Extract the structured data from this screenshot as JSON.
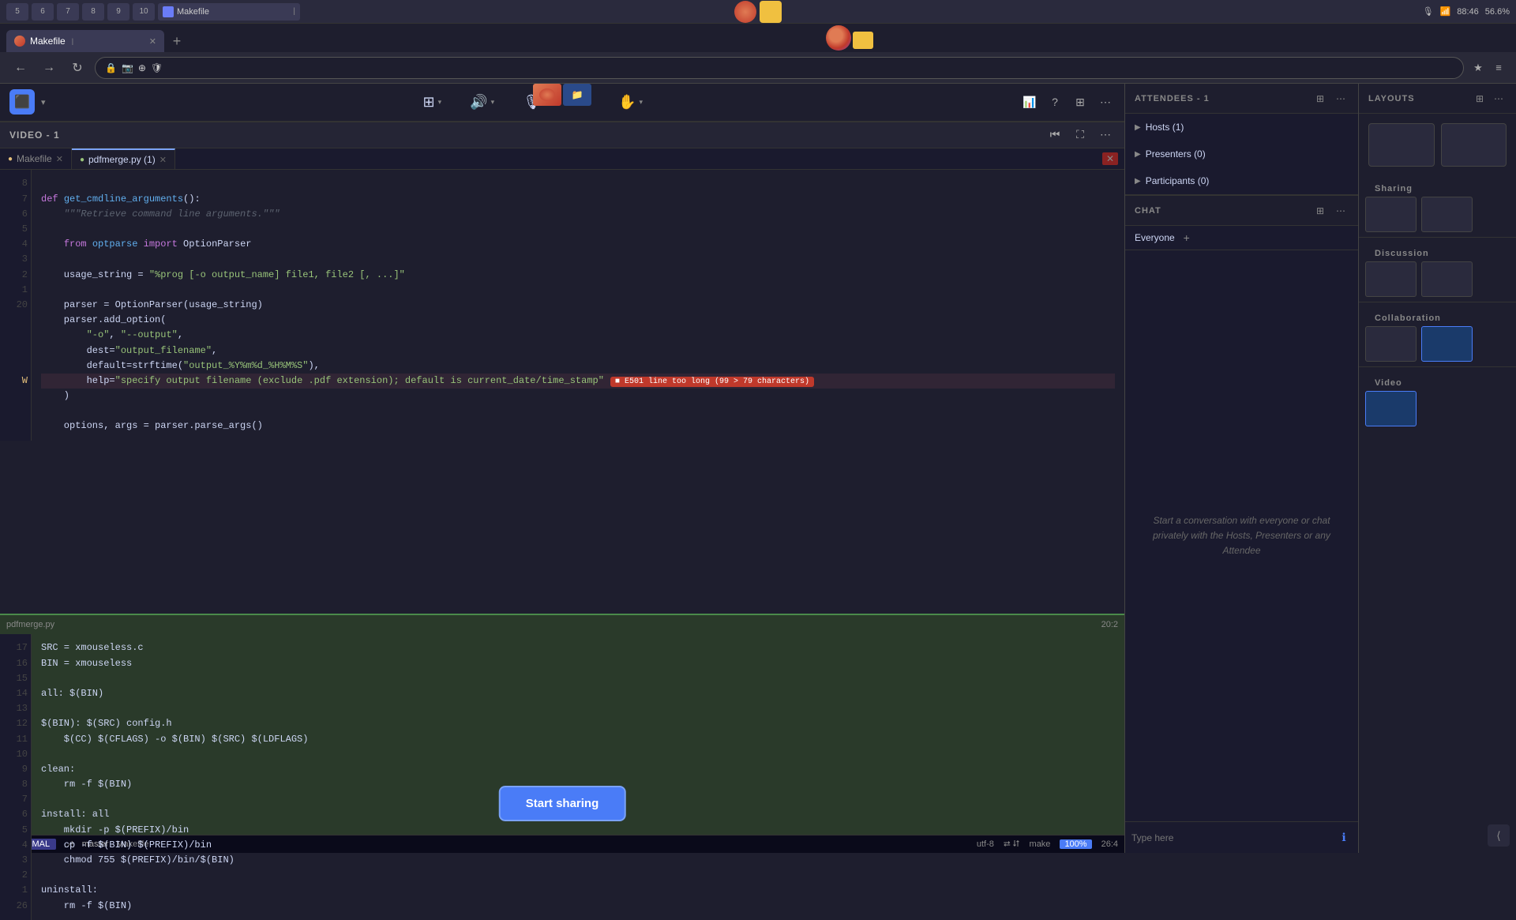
{
  "os": {
    "taskbar_items": [
      "5",
      "6",
      "7",
      "8",
      "9",
      "10"
    ],
    "time": "88:46",
    "battery": "56.6%"
  },
  "browser": {
    "tab_label": "Makefile",
    "tab_new_label": "+",
    "nav": {
      "back": "←",
      "forward": "→",
      "reload": "↻",
      "security_icon": "🔒",
      "camera_icon": "📷",
      "star_icon": "★",
      "menu_icon": "≡"
    }
  },
  "meeting_toolbar": {
    "video_label": "VIDEO - 1",
    "buttons": [
      "apps",
      "audio",
      "mic",
      "share",
      "hand",
      "more"
    ],
    "stats_icon": "📊",
    "help_icon": "?",
    "layout_icon": "⊞",
    "more_icon": "⋯"
  },
  "editor": {
    "tabs": [
      {
        "name": "Makefile",
        "type": "makefile",
        "active": false
      },
      {
        "name": "pdfmerge.py (1)",
        "type": "python",
        "active": true
      }
    ],
    "file_pdfmerge": {
      "lines": [
        {
          "num": "8",
          "content": ""
        },
        {
          "num": "7",
          "content": "def get_cmdline_arguments():"
        },
        {
          "num": "6",
          "content": "    \"\"\"Retrieve command line arguments.\"\"\""
        },
        {
          "num": "5",
          "content": ""
        },
        {
          "num": "4",
          "content": "    from optparse import OptionParser"
        },
        {
          "num": "3",
          "content": ""
        },
        {
          "num": "2",
          "content": "    usage_string = \"%prog [-o output_name] file1, file2 [, ...]\""
        },
        {
          "num": "1",
          "content": ""
        },
        {
          "num": "20",
          "content": "    parser = OptionParser(usage_string)"
        },
        {
          "num": "",
          "content": "    parser.add_option("
        },
        {
          "num": "",
          "content": "        \"-o\", \"--output\","
        },
        {
          "num": "",
          "content": "        dest=\"output_filename\","
        },
        {
          "num": "",
          "content": "        default=strftime(\"output_%Y%m%d_%H%M%S\"),"
        },
        {
          "num": "W",
          "content": "        help=\"specify output filename (exclude .pdf extension); default is current_date/time_stamp\"",
          "error": "E501 line too long (99 > 79 characters)"
        },
        {
          "num": "",
          "content": "    )"
        },
        {
          "num": "",
          "content": ""
        },
        {
          "num": "",
          "content": "    options, args = parser.parse_args()"
        }
      ]
    },
    "file_makefile": {
      "label": "pdfmerge.py",
      "cursor": "20:2",
      "lines": [
        {
          "num": "17",
          "content": "SRC = xmouseless.c"
        },
        {
          "num": "16",
          "content": "BIN = xmouseless"
        },
        {
          "num": "15",
          "content": ""
        },
        {
          "num": "14",
          "content": "all: $(BIN)"
        },
        {
          "num": "13",
          "content": ""
        },
        {
          "num": "12",
          "content": "$(BIN): $(SRC) config.h"
        },
        {
          "num": "11",
          "content": "    $(CC) $(CFLAGS) -o $(BIN) $(SRC) $(LDFLAGS)"
        },
        {
          "num": "10",
          "content": ""
        },
        {
          "num": "9",
          "content": "clean:"
        },
        {
          "num": "8",
          "content": "    rm -f $(BIN)"
        },
        {
          "num": "7",
          "content": ""
        },
        {
          "num": "6",
          "content": "install: all"
        },
        {
          "num": "5",
          "content": "    mkdir -p $(PREFIX)/bin"
        },
        {
          "num": "4",
          "content": "    cp -f $(BIN) $(PREFIX)/bin"
        },
        {
          "num": "3",
          "content": "    chmod 755 $(PREFIX)/bin/$(BIN)"
        },
        {
          "num": "2",
          "content": ""
        },
        {
          "num": "1",
          "content": "uninstall:"
        },
        {
          "num": "26",
          "content": "    rm -f $(BIN)"
        }
      ]
    },
    "status": {
      "mode": "NORMAL",
      "branch": "master",
      "filename": "Makefile",
      "encoding": "utf-8",
      "filetype": "make",
      "percent": "100%",
      "cursor": "26:4"
    }
  },
  "attendees_panel": {
    "title": "ATTENDEES - 1",
    "groups": [
      {
        "label": "Hosts (1)",
        "count": 1
      },
      {
        "label": "Presenters (0)",
        "count": 0
      },
      {
        "label": "Participants (0)",
        "count": 0
      }
    ]
  },
  "layouts_panel": {
    "title": "LAYOUTS",
    "thumbnails": [
      "thumb1",
      "thumb2",
      "sharing",
      "discussion",
      "collaboration",
      "video"
    ],
    "section_labels": [
      "Sharing",
      "Discussion",
      "Collaboration",
      "Video"
    ]
  },
  "chat_panel": {
    "title": "CHAT",
    "audience": "Everyone",
    "add_icon": "+",
    "hint_text": "Start a conversation with everyone or chat privately with the Hosts, Presenters or any Attendee",
    "input_placeholder": "Type here",
    "send_icon": "ℹ"
  },
  "sharing_button": {
    "label": "Start sharing"
  }
}
